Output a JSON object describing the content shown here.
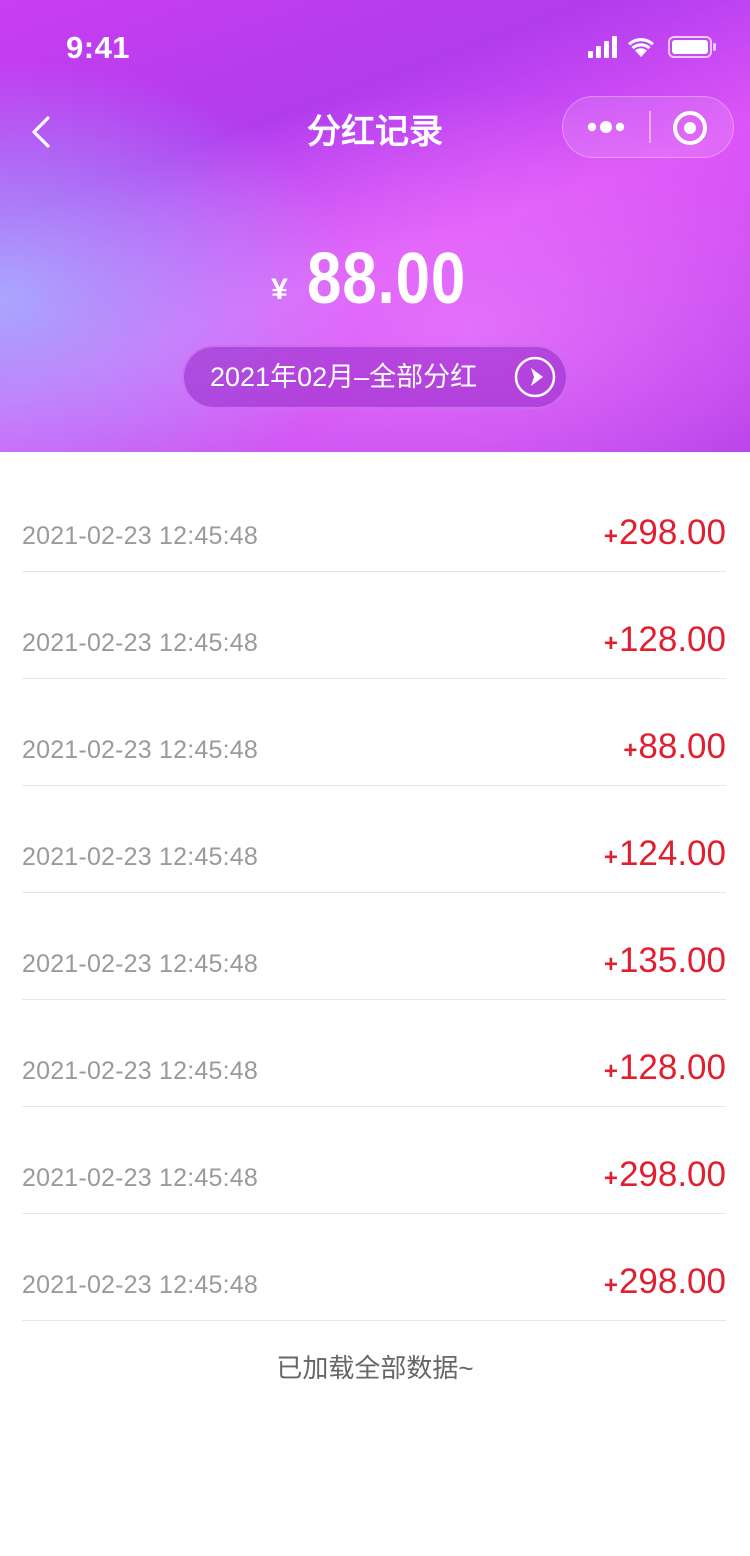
{
  "status_bar": {
    "time": "9:41"
  },
  "nav": {
    "title": "分红记录"
  },
  "summary": {
    "currency": "¥",
    "amount": "88.00",
    "period_label": "2021年02月–全部分红"
  },
  "records": [
    {
      "time": "2021-02-23 12:45:48",
      "sign": "+",
      "amount": "298.00"
    },
    {
      "time": "2021-02-23 12:45:48",
      "sign": "+",
      "amount": "128.00"
    },
    {
      "time": "2021-02-23 12:45:48",
      "sign": "+",
      "amount": "88.00"
    },
    {
      "time": "2021-02-23 12:45:48",
      "sign": "+",
      "amount": "124.00"
    },
    {
      "time": "2021-02-23 12:45:48",
      "sign": "+",
      "amount": "135.00"
    },
    {
      "time": "2021-02-23 12:45:48",
      "sign": "+",
      "amount": "128.00"
    },
    {
      "time": "2021-02-23 12:45:48",
      "sign": "+",
      "amount": "298.00"
    },
    {
      "time": "2021-02-23 12:45:48",
      "sign": "+",
      "amount": "298.00"
    }
  ],
  "footer": {
    "note": "已加载全部数据~"
  },
  "colors": {
    "header_gradient_start": "#c93ef0",
    "header_gradient_mid": "#dd55f8",
    "amount_red": "#e02030",
    "date_gray": "#9a9a9a"
  },
  "icons": {
    "back": "chevron-left-icon",
    "more": "more-dots-icon",
    "close": "target-circle-icon",
    "period_arrow": "play-arrow-circle-icon",
    "signal": "cellular-signal-icon",
    "wifi": "wifi-icon",
    "battery": "battery-icon"
  }
}
